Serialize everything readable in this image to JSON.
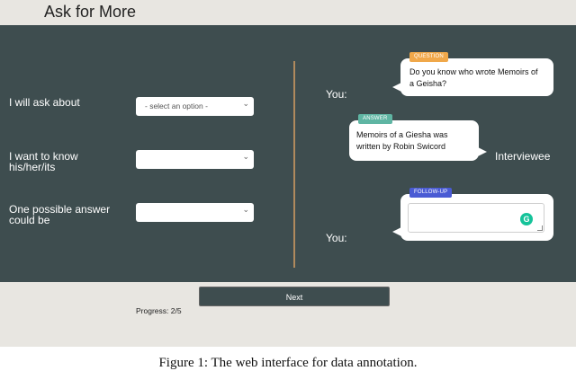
{
  "header": {
    "title": "Ask for More"
  },
  "form": {
    "fields": [
      {
        "label": "I will ask about",
        "value": "- select an option -"
      },
      {
        "label": "I want to know his/her/its",
        "value": ""
      },
      {
        "label": "One possible answer could be",
        "value": ""
      }
    ]
  },
  "chat": {
    "question": {
      "speaker": "You:",
      "tag": "QUESTION",
      "text": "Do you know who wrote Memoirs of a Geisha?",
      "tag_color": "#f0a84a"
    },
    "answer": {
      "speaker": "Interviewee",
      "tag": "ANSWER",
      "text": "Memoirs of a Giesha was written by Robin Swicord",
      "tag_color": "#5fb5a3"
    },
    "followup": {
      "speaker": "You:",
      "tag": "FOLLOW-UP",
      "value": "",
      "tag_color": "#4a5bd4",
      "grammar_icon": "G"
    }
  },
  "footer": {
    "next_label": "Next",
    "progress": "Progress: 2/5"
  },
  "caption": "Figure 1: The web interface for data annotation."
}
